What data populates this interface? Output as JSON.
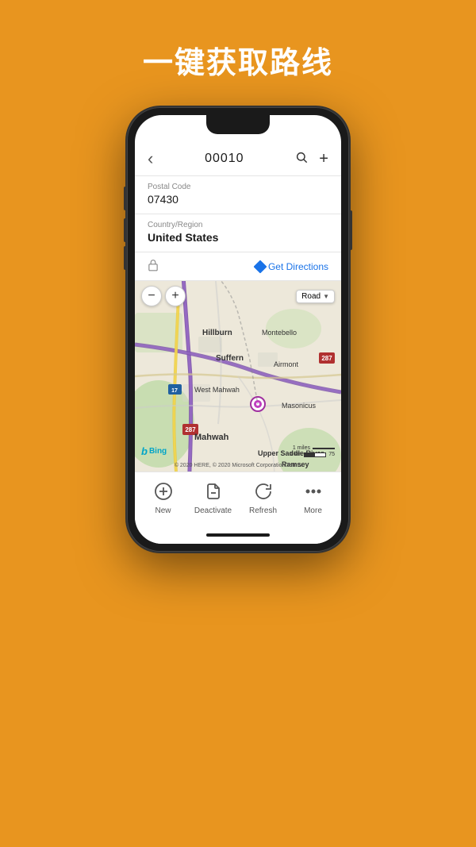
{
  "hero": {
    "title": "一键获取路线"
  },
  "nav": {
    "back_icon": "‹",
    "title": "00010",
    "search_icon": "search",
    "add_icon": "+"
  },
  "fields": {
    "postal_code_label": "Postal Code",
    "postal_code_value": "07430",
    "country_label": "Country/Region",
    "country_value": "United States"
  },
  "directions": {
    "get_directions_label": "Get Directions"
  },
  "map": {
    "type_label": "Road",
    "copyright": "© 2020 HERE, © 2020 Microsoft Corporation  Terms",
    "scale_miles": "1 miles",
    "scale_km": "1 km",
    "bing_label": "Bing"
  },
  "toolbar": {
    "new_label": "New",
    "deactivate_label": "Deactivate",
    "refresh_label": "Refresh",
    "more_label": "More"
  },
  "colors": {
    "orange": "#E8951F",
    "blue": "#1a73e8",
    "map_bg": "#e8e0d0",
    "road_purple": "#6b3fa0",
    "road_yellow": "#f5c842"
  }
}
